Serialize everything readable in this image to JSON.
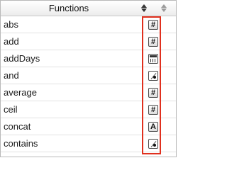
{
  "header": {
    "title": "Functions",
    "sort_icon": "sort-arrows-icon"
  },
  "functions": [
    {
      "name": "abs",
      "type_icon": "number-type-icon",
      "type_glyph": "#"
    },
    {
      "name": "add",
      "type_icon": "number-type-icon",
      "type_glyph": "#"
    },
    {
      "name": "addDays",
      "type_icon": "date-type-icon",
      "type_glyph": ""
    },
    {
      "name": "and",
      "type_icon": "logical-type-icon",
      "type_glyph": ""
    },
    {
      "name": "average",
      "type_icon": "number-type-icon",
      "type_glyph": "#"
    },
    {
      "name": "ceil",
      "type_icon": "number-type-icon",
      "type_glyph": "#"
    },
    {
      "name": "concat",
      "type_icon": "text-type-icon",
      "type_glyph": "A"
    },
    {
      "name": "contains",
      "type_icon": "logical-type-icon",
      "type_glyph": ""
    }
  ],
  "colors": {
    "highlight": "#e0301e",
    "row_divider": "#e2e2e2"
  }
}
